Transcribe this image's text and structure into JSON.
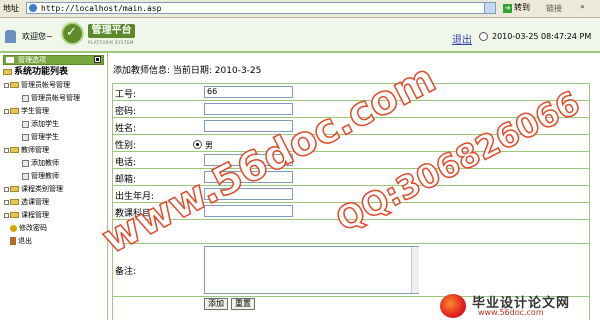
{
  "browser": {
    "address_label": "地址",
    "url": "http://localhost/main.asp",
    "go_label": "转到",
    "links_label": "链接",
    "links_chevron": "»"
  },
  "header": {
    "welcome": "欢迎您~",
    "logo_title": "管理平台",
    "logo_subtitle": "PLATFORM SYSTEM",
    "logout": "退出",
    "datetime": "2010-03-25 08:47:24 PM"
  },
  "sidebar": {
    "panel_title": "管理选项",
    "root": "系统功能列表",
    "items": [
      {
        "label": "管理员帐号管理",
        "level": 1,
        "icon": "folder-icon"
      },
      {
        "label": "管理员帐号管理",
        "level": 2,
        "icon": "pen-icon"
      },
      {
        "label": "学生管理",
        "level": 1,
        "icon": "folder-icon"
      },
      {
        "label": "添加学生",
        "level": 2,
        "icon": "pen-icon"
      },
      {
        "label": "管理学生",
        "level": 2,
        "icon": "pen-icon"
      },
      {
        "label": "教师管理",
        "level": 1,
        "icon": "folder-icon"
      },
      {
        "label": "添加教师",
        "level": 2,
        "icon": "pen-icon"
      },
      {
        "label": "管理教师",
        "level": 2,
        "icon": "pen-icon"
      },
      {
        "label": "课程类别管理",
        "level": 1,
        "icon": "folder-icon"
      },
      {
        "label": "选课管理",
        "level": 1,
        "icon": "folder-icon"
      },
      {
        "label": "课程管理",
        "level": 1,
        "icon": "folder-icon"
      },
      {
        "label": "修改密码",
        "level": 1,
        "icon": "key-icon"
      },
      {
        "label": "退出",
        "level": 1,
        "icon": "door-icon"
      }
    ]
  },
  "main": {
    "title": "添加教师信息:  当前日期: 2010-3-25",
    "fields": {
      "id_label": "工号:",
      "id_value": "66",
      "password_label": "密码:",
      "name_label": "姓名:",
      "gender_label": "性别:",
      "gender_option": "男",
      "phone_label": "电话:",
      "email_label": "邮箱:",
      "birth_label": "出生年月:",
      "subject_label": "教课科目:",
      "notes_label": "备注:"
    },
    "buttons": {
      "add": "添加",
      "reset": "重置"
    }
  },
  "watermarks": {
    "site": "www.56doc.com",
    "qq": "QQ:306826066",
    "bottom_title": "毕业设计论文网",
    "bottom_url": "www.56doc.com"
  },
  "colors": {
    "accent_green": "#77a83f",
    "watermark_red": "#e04a2a",
    "link_blue": "#3344aa"
  }
}
